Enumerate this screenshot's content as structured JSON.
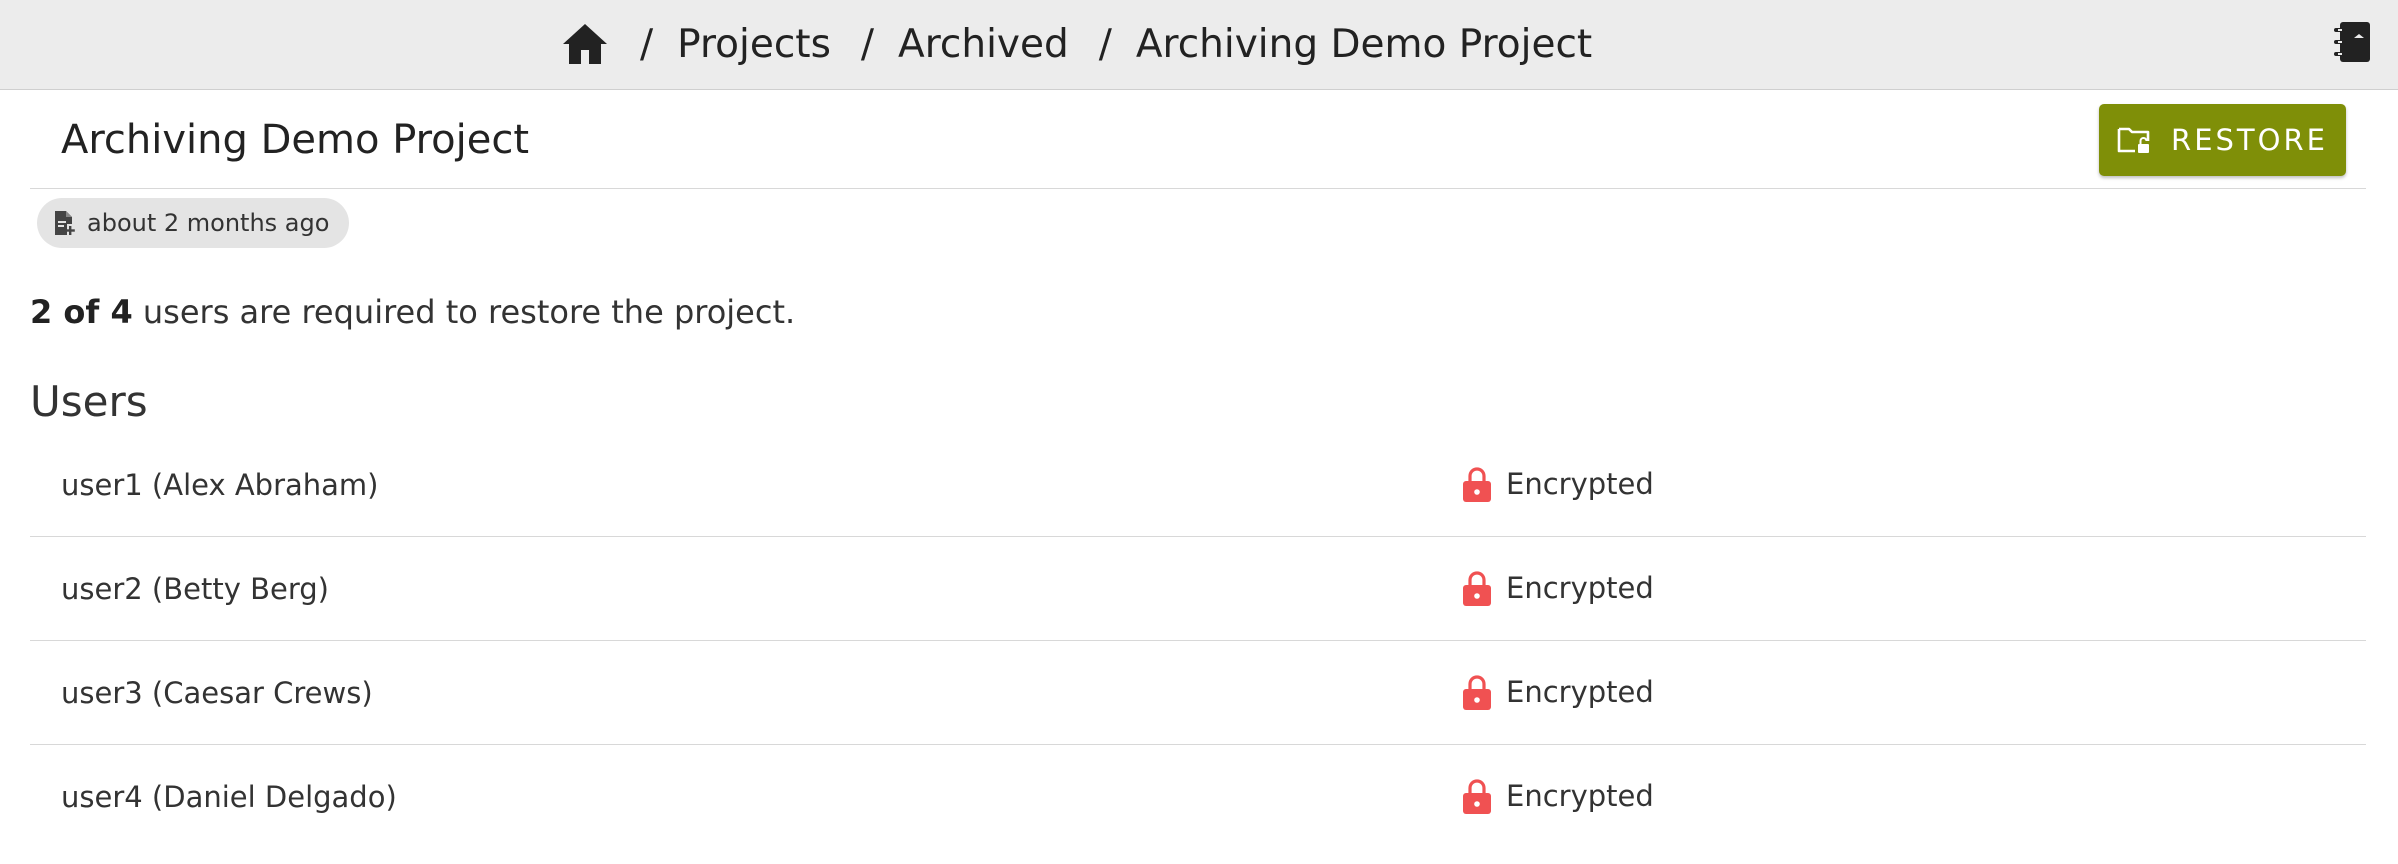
{
  "breadcrumb": {
    "home_icon": "home-icon",
    "separator": "/",
    "items": [
      "Projects",
      "Archived",
      "Archiving Demo Project"
    ]
  },
  "topbar": {
    "notebook_icon": "notebook-icon"
  },
  "project": {
    "title": "Archiving Demo Project",
    "created_label": "about 2 months ago",
    "created_icon": "file-add-icon"
  },
  "restore_button": {
    "label": "RESTORE",
    "icon": "folder-unlock-icon",
    "color": "#7f8f08"
  },
  "requirement": {
    "count": "2 of 4",
    "text": " users are required to restore the project."
  },
  "users": {
    "heading": "Users",
    "rows": [
      {
        "name": "user1 (Alex Abraham)",
        "status": "Encrypted"
      },
      {
        "name": "user2 (Betty Berg)",
        "status": "Encrypted"
      },
      {
        "name": "user3 (Caesar Crews)",
        "status": "Encrypted"
      },
      {
        "name": "user4 (Daniel Delgado)",
        "status": "Encrypted"
      }
    ],
    "status_icon": "lock-icon",
    "status_color": "#f05152"
  }
}
